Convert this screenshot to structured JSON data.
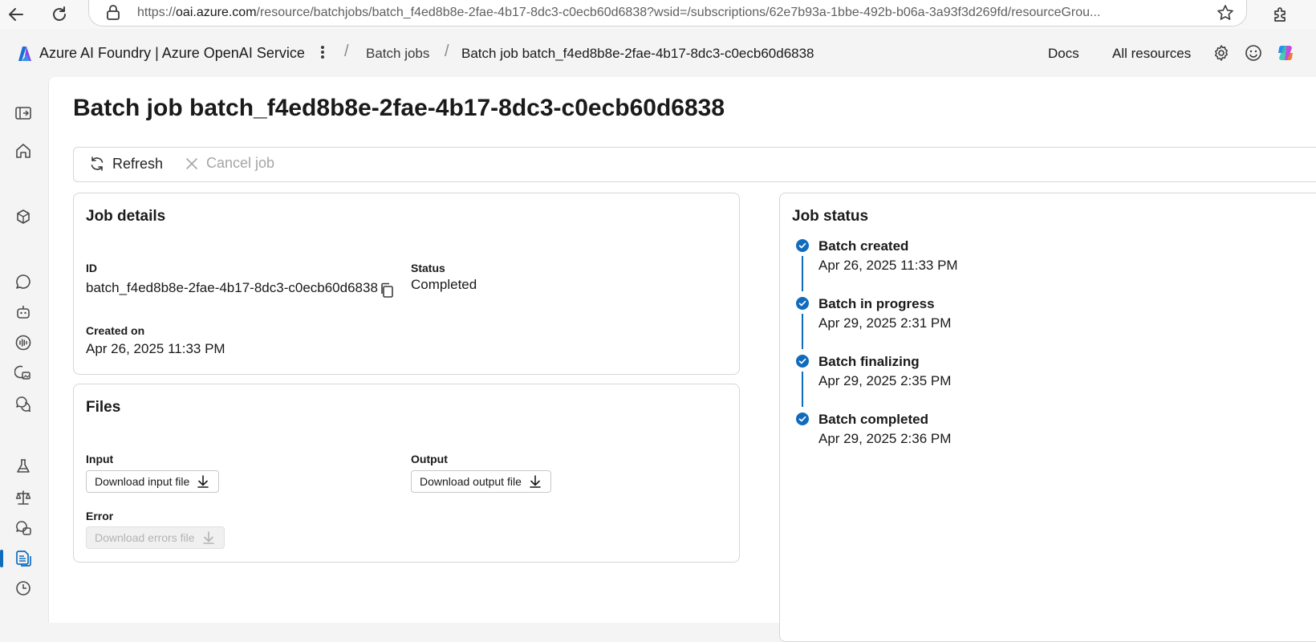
{
  "browser": {
    "url_prefix": "https://",
    "url_host": "oai.azure.com",
    "url_rest": "/resource/batchjobs/batch_f4ed8b8e-2fae-4b17-8dc3-c0ecb60d6838?wsid=/subscriptions/62e7b93a-1bbe-492b-b06a-3a93f3d269fd/resourceGrou..."
  },
  "header": {
    "brand_title": "Azure AI Foundry | Azure OpenAI Service",
    "breadcrumbs": [
      "Batch jobs",
      "Batch job batch_f4ed8b8e-2fae-4b17-8dc3-c0ecb60d6838"
    ],
    "docs_label": "Docs",
    "all_resources_label": "All resources"
  },
  "page": {
    "title": "Batch job batch_f4ed8b8e-2fae-4b17-8dc3-c0ecb60d6838"
  },
  "toolbar": {
    "refresh_label": "Refresh",
    "cancel_label": "Cancel job"
  },
  "job_details": {
    "title": "Job details",
    "id_label": "ID",
    "id_value": "batch_f4ed8b8e-2fae-4b17-8dc3-c0ecb60d6838",
    "status_label": "Status",
    "status_value": "Completed",
    "created_label": "Created on",
    "created_value": "Apr 26, 2025 11:33 PM"
  },
  "files": {
    "title": "Files",
    "input_label": "Input",
    "input_button": "Download input file",
    "output_label": "Output",
    "output_button": "Download output file",
    "error_label": "Error",
    "error_button": "Download errors file"
  },
  "job_status": {
    "title": "Job status",
    "steps": [
      {
        "title": "Batch created",
        "time": "Apr 26, 2025 11:33 PM"
      },
      {
        "title": "Batch in progress",
        "time": "Apr 29, 2025 2:31 PM"
      },
      {
        "title": "Batch finalizing",
        "time": "Apr 29, 2025 2:35 PM"
      },
      {
        "title": "Batch completed",
        "time": "Apr 29, 2025 2:36 PM"
      }
    ]
  },
  "colors": {
    "accent": "#0f6cbd",
    "disabled_text": "#a6a6a6"
  }
}
